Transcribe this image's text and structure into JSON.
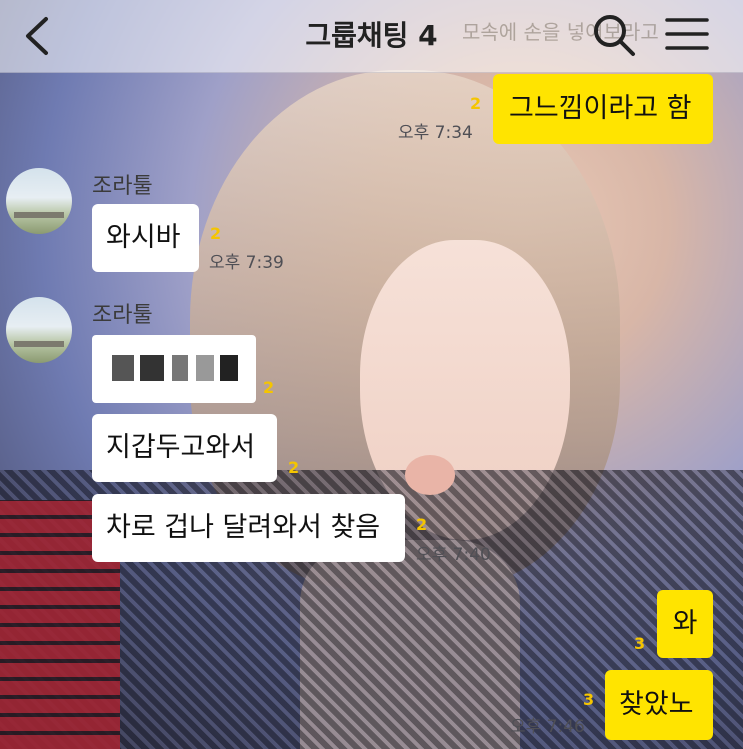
{
  "header": {
    "title": "그룹채팅 4",
    "faded_overlay": "모속에 손을 넣어보라고"
  },
  "messages": {
    "m1": {
      "text": "그느낌이라고 함",
      "unread": "2",
      "time": "오후 7:34"
    },
    "m2": {
      "sender": "조라툴",
      "text": "와시바",
      "unread": "2",
      "time": "오후 7:39"
    },
    "m3": {
      "sender": "조라툴",
      "unread": "2"
    },
    "m4": {
      "text": "지갑두고와서",
      "unread": "2"
    },
    "m5": {
      "text": "차로 겁나 달려와서 찾음",
      "unread": "2",
      "time": "오후 7:40"
    },
    "m6": {
      "text": "와",
      "unread": "3"
    },
    "m7": {
      "text": "찾았노",
      "unread": "3",
      "time": "오후 7:46"
    }
  },
  "colors": {
    "my_bubble": "#ffe400",
    "their_bubble": "#ffffff",
    "unread": "#f5c500"
  },
  "icons": {
    "back": "chevron-left-icon",
    "search": "search-icon",
    "menu": "hamburger-menu-icon"
  }
}
